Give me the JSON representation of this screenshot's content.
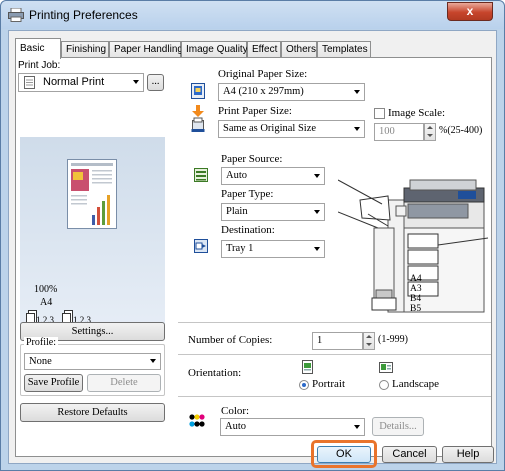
{
  "window": {
    "title": "Printing Preferences",
    "close_symbol": "x",
    "icons": {
      "title": "printer-icon",
      "close": "close-icon"
    }
  },
  "tabs": [
    "Basic",
    "Finishing",
    "Paper Handling",
    "Image Quality",
    "Effect",
    "Others",
    "Templates"
  ],
  "active_tab": "Basic",
  "print_job": {
    "label": "Print Job:",
    "value": "Normal Print",
    "ellipsis": "..."
  },
  "preview": {
    "zoom": "100%",
    "paper": "A4",
    "collate_a": "1.2.3",
    "collate_b": "1.2.3"
  },
  "settings_button": "Settings...",
  "profile": {
    "label": "Profile:",
    "value": "None",
    "save": "Save Profile",
    "delete": "Delete"
  },
  "restore_button": "Restore Defaults",
  "original_size": {
    "label": "Original Paper Size:",
    "value": "A4 (210 x 297mm)"
  },
  "print_size": {
    "label": "Print Paper Size:",
    "value": "Same as Original Size"
  },
  "image_scale": {
    "label": "Image Scale:",
    "value": "100",
    "range": "%(25-400)",
    "checked": false
  },
  "paper_source": {
    "label": "Paper Source:",
    "value": "Auto"
  },
  "paper_type": {
    "label": "Paper Type:",
    "value": "Plain"
  },
  "destination": {
    "label": "Destination:",
    "value": "Tray 1"
  },
  "trays": [
    "A4",
    "A3",
    "B4",
    "B5"
  ],
  "copies": {
    "label": "Number of Copies:",
    "value": "1",
    "range": "(1-999)"
  },
  "orientation": {
    "label": "Orientation:",
    "portrait": "Portrait",
    "landscape": "Landscape",
    "selected": "Portrait"
  },
  "color": {
    "label": "Color:",
    "value": "Auto",
    "details": "Details..."
  },
  "footer": {
    "ok": "OK",
    "cancel": "Cancel",
    "help": "Help"
  },
  "colors": {
    "ok_highlight": "#e9742c",
    "close_button": "#c7452c",
    "title_bar": "#bcd3ea"
  }
}
